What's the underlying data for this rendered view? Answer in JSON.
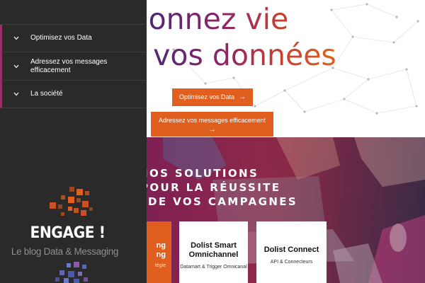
{
  "hero": {
    "title_line1": "Donnez vie",
    "title_line2": "à vos données",
    "cta_primary": "Optimisez vos Data",
    "cta_secondary": "Adressez vos messages efficacement",
    "arrow_icon": "arrow-right-icon"
  },
  "side_menu": {
    "items": [
      {
        "label": "Optimisez vos Data",
        "icon": "chevron-down-icon"
      },
      {
        "label": "Adressez vos messages efficacement",
        "icon": "chevron-down-icon"
      },
      {
        "label": "La société",
        "icon": "chevron-down-icon"
      }
    ]
  },
  "blog_logo": {
    "title": "ENGAGE !",
    "subtitle": "Le blog Data & Messaging"
  },
  "solutions": {
    "title_line1": "NOS SOLUTIONS",
    "title_line2": "POUR LA RÉUSSITE",
    "title_line3": "DE VOS CAMPAGNES",
    "cards": [
      {
        "title": "Dolist Data Marketing",
        "subtitle": "Stratégie",
        "visible_title": "ng\nng",
        "visible_subtitle": "tégie"
      },
      {
        "title": "Dolist Smart Omnichannel",
        "subtitle": "Datamart & Trigger Omnicanal"
      },
      {
        "title": "Dolist Connect",
        "subtitle": "API & Connecteurs"
      }
    ]
  },
  "colors": {
    "accent": "#e05f1f",
    "side_bg": "#2a2a2a",
    "menu_marker": "#9c2f6a",
    "gradient_start": "#3b2a7a",
    "gradient_end": "#e2621f"
  }
}
